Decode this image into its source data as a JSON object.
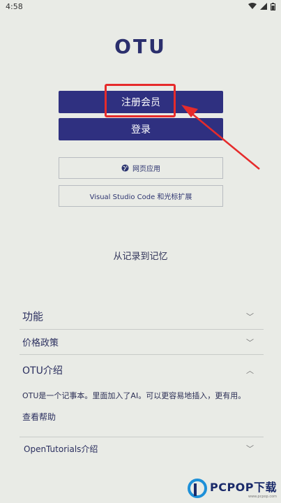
{
  "status_bar": {
    "time": "4:58"
  },
  "app": {
    "logo": "OTU"
  },
  "buttons": {
    "register": "注册会员",
    "login": "登录",
    "web_app": "网页应用",
    "vscode": "Visual Studio Code 和光标扩展"
  },
  "tagline": "从记录到记忆",
  "sections": [
    {
      "title": "功能",
      "expanded": false
    },
    {
      "title": "价格政策",
      "expanded": false
    },
    {
      "title": "OTU介绍",
      "expanded": true,
      "body": "OTU是一个记事本。里面加入了AI。可以更容易地插入，更有用。",
      "link": "查看帮助"
    },
    {
      "title": "OpenTutorials介绍",
      "expanded": false
    }
  ],
  "watermark": {
    "text": "PCPOP下载",
    "sub": "www.pcpop.com"
  },
  "colors": {
    "primary": "#2f3080",
    "highlight": "#e62b2b",
    "background": "#e9ebe6"
  }
}
